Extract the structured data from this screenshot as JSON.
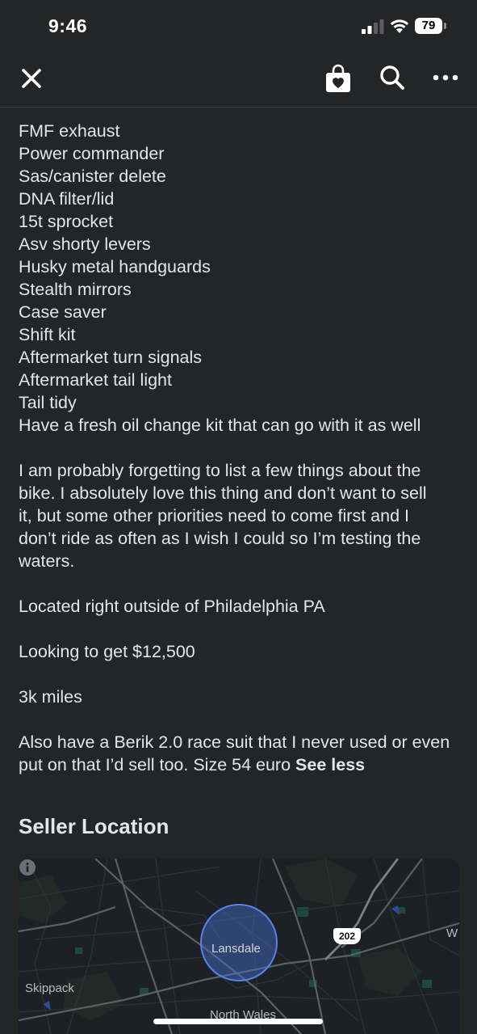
{
  "status_bar": {
    "time": "9:46",
    "battery": "79"
  },
  "header": {
    "close_icon": "close-icon",
    "shop_icon": "shopping-bag-heart-icon",
    "search_icon": "search-icon",
    "more_icon": "more-options-icon"
  },
  "description": {
    "features": [
      "FMF exhaust",
      "Power commander",
      "Sas/canister delete",
      "DNA filter/lid",
      "15t sprocket",
      "Asv shorty levers",
      "Husky metal handguards",
      "Stealth mirrors",
      "Case saver",
      "Shift kit",
      "Aftermarket turn signals",
      "Aftermarket tail light",
      "Tail tidy",
      "Have a fresh oil change kit that can go with it as well"
    ],
    "paragraph_1_lines": [
      "I am probably forgetting to list a few things about the",
      "bike. I absolutely love this thing and don’t want to sell",
      "it, but some other priorities need to come first and I",
      "don’t ride as often as I wish I could so I’m testing the",
      "waters."
    ],
    "location": "Located right outside of Philadelphia PA",
    "price": "Looking to get $12,500",
    "mileage": "3k miles",
    "paragraph_5_line_1": "Also have a Berik 2.0 race suit that I never used or even",
    "paragraph_5_line_2": "put on that I’d sell too. Size 54 euro ",
    "see_less": "See less"
  },
  "seller_location": {
    "title": "Seller Location",
    "map_labels": {
      "lansdale": "Lansdale",
      "skippack": "Skippack",
      "north_wales": "North Wales",
      "edge_w": "W",
      "route": "202"
    }
  },
  "colors": {
    "background": "#242526",
    "text": "#e4e6eb",
    "map_background": "#1d2125",
    "map_circle": "#4a6fd1"
  }
}
